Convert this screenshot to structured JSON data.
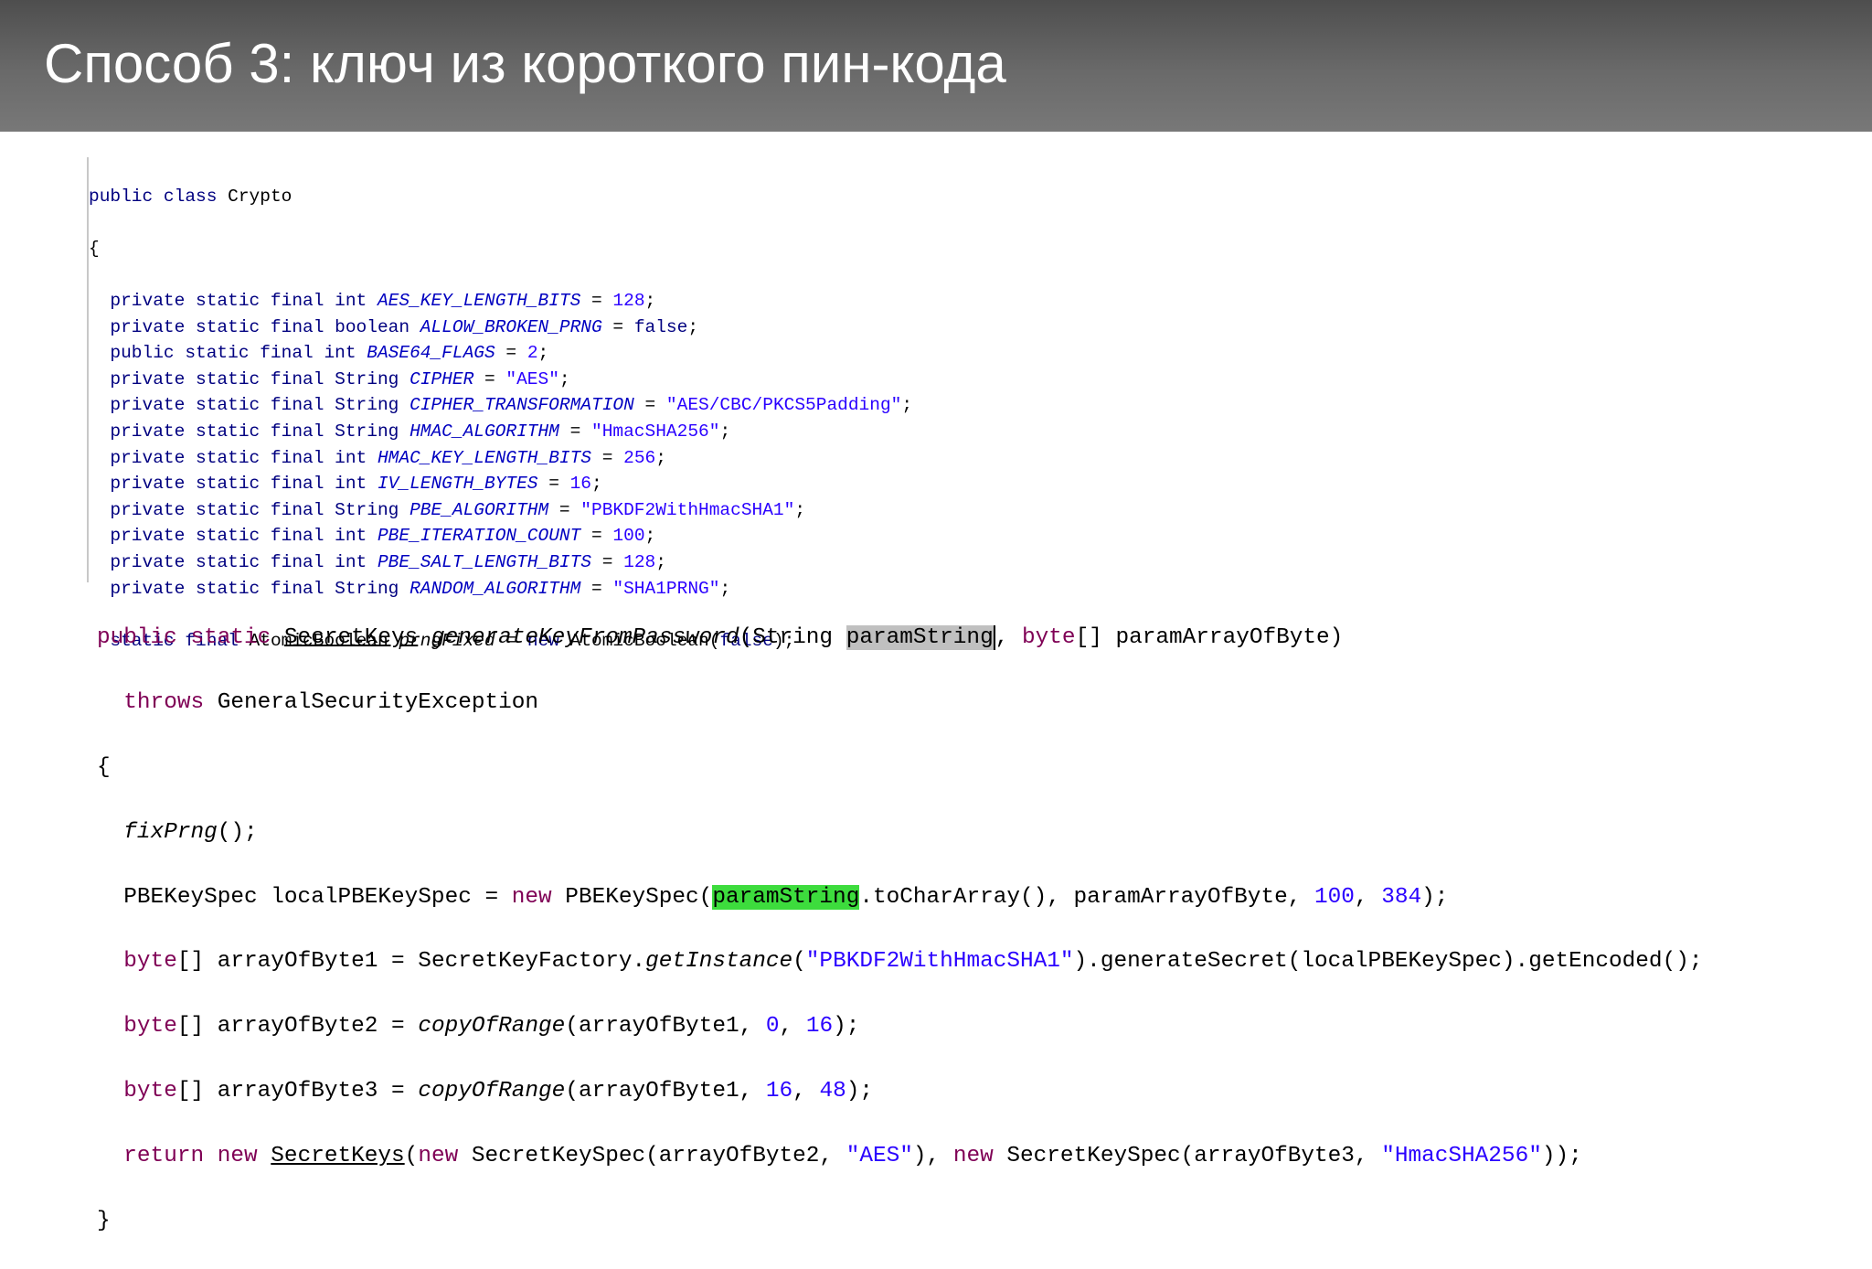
{
  "slide": {
    "title": "Способ 3: ключ из короткого пин-кода"
  },
  "code1": {
    "l1": {
      "kw": "public class",
      "name": " Crypto"
    },
    "l2": "{",
    "fields": [
      {
        "mods": "private static final int",
        "name": "AES_KEY_LENGTH_BITS",
        "eq": " = ",
        "val": "128",
        "end": ";",
        "val_type": "num"
      },
      {
        "mods": "private static final boolean",
        "name": "ALLOW_BROKEN_PRNG",
        "eq": " = ",
        "val": "false",
        "end": ";",
        "val_type": "kw"
      },
      {
        "mods": "public static final int",
        "name": "BASE64_FLAGS",
        "eq": " = ",
        "val": "2",
        "end": ";",
        "val_type": "num"
      },
      {
        "mods": "private static final String",
        "name": "CIPHER",
        "eq": " = ",
        "val": "\"AES\"",
        "end": ";",
        "val_type": "str"
      },
      {
        "mods": "private static final String",
        "name": "CIPHER_TRANSFORMATION",
        "eq": " = ",
        "val": "\"AES/CBC/PKCS5Padding\"",
        "end": ";",
        "val_type": "str"
      },
      {
        "mods": "private static final String",
        "name": "HMAC_ALGORITHM",
        "eq": " = ",
        "val": "\"HmacSHA256\"",
        "end": ";",
        "val_type": "str"
      },
      {
        "mods": "private static final int",
        "name": "HMAC_KEY_LENGTH_BITS",
        "eq": " = ",
        "val": "256",
        "end": ";",
        "val_type": "num"
      },
      {
        "mods": "private static final int",
        "name": "IV_LENGTH_BYTES",
        "eq": " = ",
        "val": "16",
        "end": ";",
        "val_type": "num"
      },
      {
        "mods": "private static final String",
        "name": "PBE_ALGORITHM",
        "eq": " = ",
        "val": "\"PBKDF2WithHmacSHA1\"",
        "end": ";",
        "val_type": "str"
      },
      {
        "mods": "private static final int",
        "name": "PBE_ITERATION_COUNT",
        "eq": " = ",
        "val": "100",
        "end": ";",
        "val_type": "num"
      },
      {
        "mods": "private static final int",
        "name": "PBE_SALT_LENGTH_BITS",
        "eq": " = ",
        "val": "128",
        "end": ";",
        "val_type": "num"
      },
      {
        "mods": "private static final String",
        "name": "RANDOM_ALGORITHM",
        "eq": " = ",
        "val": "\"SHA1PRNG\"",
        "end": ";",
        "val_type": "str"
      }
    ],
    "last": {
      "mods": "static final",
      "type": " AtomicBoolean ",
      "name": "prngFixed",
      "eq": " = ",
      "kw_new": "new",
      "rest": " AtomicBoolean(",
      "val": "false",
      "end": ");"
    }
  },
  "code2": {
    "sig": {
      "kw": "public static ",
      "ret": "SecretKeys",
      "sp": " ",
      "method": "generateKeyFromPassword",
      "p1": "(String ",
      "arg1": "paramString",
      "comma": ", ",
      "kw_byte": "byte",
      "p2": "[] paramArrayOfByte)"
    },
    "throws": {
      "kw": "throws",
      "rest": " GeneralSecurityException"
    },
    "open": "{",
    "fix": {
      "name": "fixPrng",
      "rest": "();"
    },
    "spec": {
      "a": "PBEKeySpec localPBEKeySpec = ",
      "kw_new": "new",
      "b": " PBEKeySpec(",
      "arg": "paramString",
      "c": ".toCharArray(), paramArrayOfByte, ",
      "n1": "100",
      "d": ", ",
      "n2": "384",
      "e": ");"
    },
    "b1": {
      "kw": "byte",
      "a": "[] arrayOfByte1 = SecretKeyFactory.",
      "m": "getInstance",
      "b": "(",
      "s": "\"PBKDF2WithHmacSHA1\"",
      "c": ").generateSecret(localPBEKeySpec).getEncoded();"
    },
    "b2": {
      "kw": "byte",
      "a": "[] arrayOfByte2 = ",
      "m": "copyOfRange",
      "b": "(arrayOfByte1, ",
      "n1": "0",
      "c": ", ",
      "n2": "16",
      "d": ");"
    },
    "b3": {
      "kw": "byte",
      "a": "[] arrayOfByte3 = ",
      "m": "copyOfRange",
      "b": "(arrayOfByte1, ",
      "n1": "16",
      "c": ", ",
      "n2": "48",
      "d": ");"
    },
    "ret": {
      "kw": "return new",
      "sp": " ",
      "cls": "SecretKeys",
      "a": "(",
      "kw_new1": "new",
      "b": " SecretKeySpec(arrayOfByte2, ",
      "s1": "\"AES\"",
      "c": "), ",
      "kw_new2": "new",
      "d": " SecretKeySpec(arrayOfByte3, ",
      "s2": "\"HmacSHA256\"",
      "e": "));"
    },
    "close": "}"
  }
}
